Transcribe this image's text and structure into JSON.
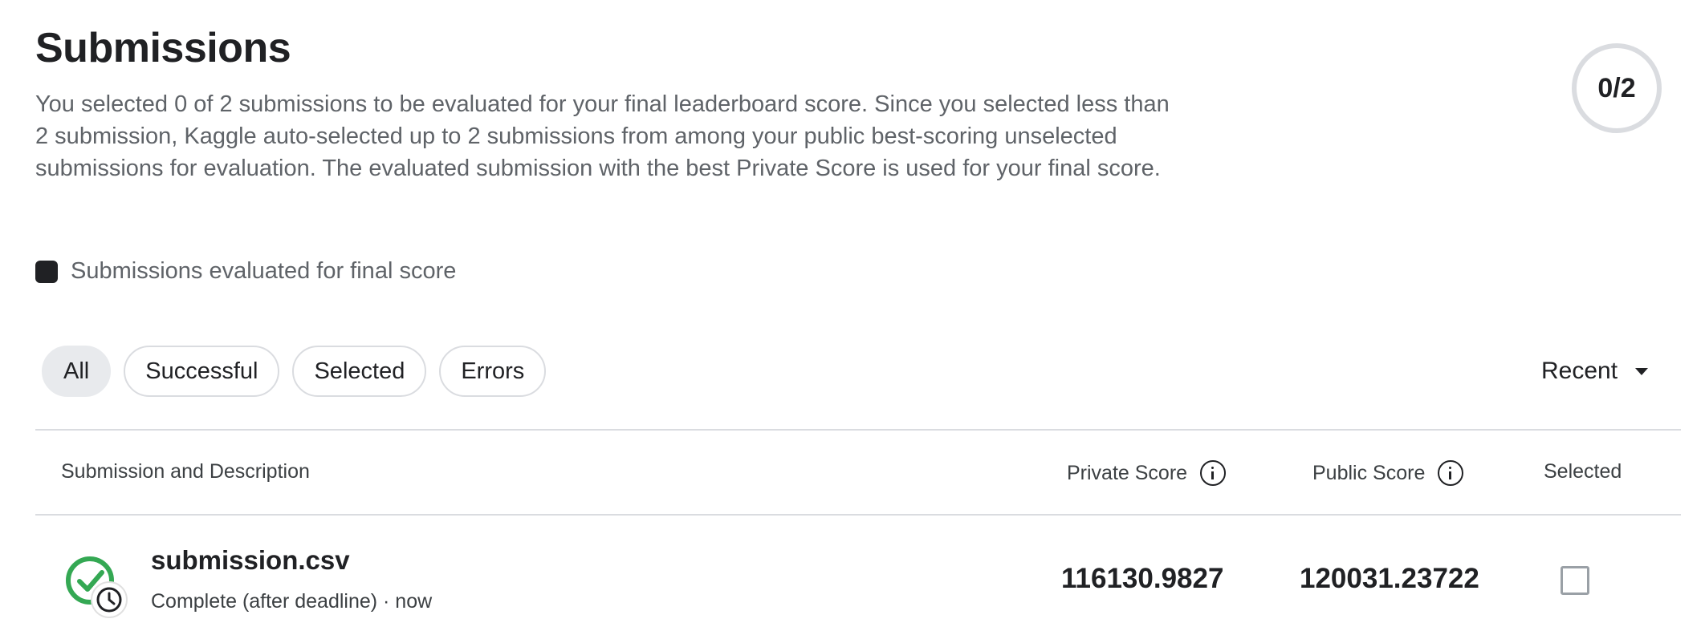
{
  "header": {
    "title": "Submissions",
    "description": "You selected 0 of 2 submissions to be evaluated for your final leaderboard score. Since you selected less than 2 submission, Kaggle auto-selected up to 2 submissions from among your public best-scoring unselected submissions for evaluation. The evaluated submission with the best Private Score is used for your final score.",
    "counter": "0/2"
  },
  "legend": {
    "label": "Submissions evaluated for final score",
    "swatch_color": "#202124"
  },
  "filters": {
    "chips": [
      {
        "label": "All",
        "active": true
      },
      {
        "label": "Successful",
        "active": false
      },
      {
        "label": "Selected",
        "active": false
      },
      {
        "label": "Errors",
        "active": false
      }
    ]
  },
  "sort": {
    "label": "Recent",
    "icon": "caret-down-icon"
  },
  "table": {
    "headers": {
      "description": "Submission and Description",
      "private_score": "Private Score",
      "public_score": "Public Score",
      "selected": "Selected"
    },
    "rows": [
      {
        "filename": "submission.csv",
        "status": "Complete (after deadline) · now",
        "status_icon": "check-clock-icon",
        "status_color": "#34a853",
        "private_score": "116130.9827",
        "public_score": "120031.23722",
        "selected": false
      }
    ]
  }
}
